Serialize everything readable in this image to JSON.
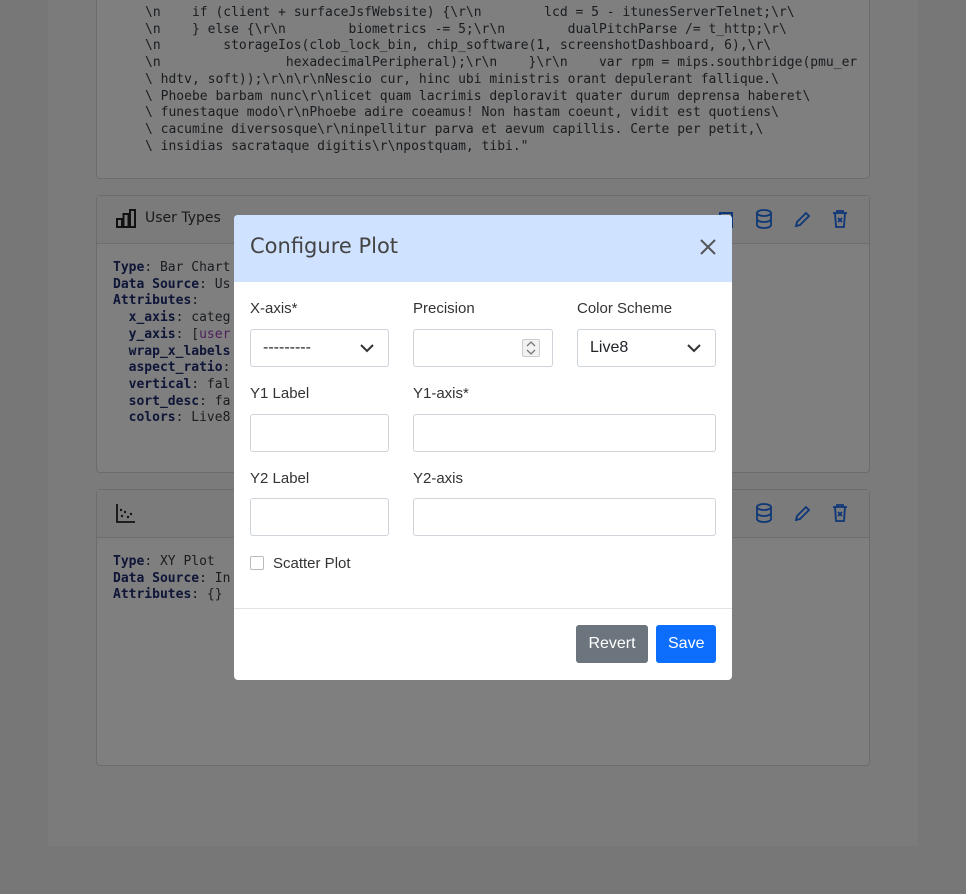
{
  "background": {
    "code_lines": [
      "\\n    if (client + surfaceJsfWebsite) {\\r\\n        lcd = 5 - itunesServerTelnet;\\r\\",
      "\\n    } else {\\r\\n        biometrics -= 5;\\r\\n        dualPitchParse /= t_http;\\r\\",
      "\\n        storageIos(clob_lock_bin, chip_software(1, screenshotDashboard, 6),\\r\\",
      "\\n                hexadecimalPeripheral);\\r\\n    }\\r\\n    var rpm = mips.southbridge(pmu_er",
      "\\ hdtv, soft));\\r\\n\\r\\nNescio cur, hinc ubi ministris orant depulerant fallique.\\",
      "\\ Phoebe barbam nunc\\r\\nlicet quam lacrimis deploravit quater durum deprensa haberet\\",
      "\\ funestaque modo\\r\\nPhoebe adire coeamus! Non hastam coeunt, vidit est quotiens\\",
      "\\ cacumine diversosque\\r\\ninpellitur parva et aevum capillis. Certe per petit,\\",
      "\\ insidias sacrataque digitis\\r\\npostquam, tibi.\""
    ],
    "user_types_card": {
      "title": "User Types",
      "type_key": "Type",
      "type_val": ": Bar Chart",
      "source_key": "Data Source",
      "source_val": ": Us",
      "attr_key": "Attributes",
      "attr_colon": ":",
      "x_axis_key": "x_axis",
      "x_axis_val": ": categ",
      "y_axis_key": "y_axis",
      "y_axis_val": ": [",
      "y_axis_purple": "user",
      "wrap_key": "wrap_x_labels",
      "aspect_key": "aspect_ratio",
      "aspect_val": ":",
      "vertical_key": "vertical",
      "vertical_val": ": fal",
      "sort_key": "sort_desc",
      "sort_val": ": fa",
      "colors_key": "colors",
      "colors_val": ": Live8"
    },
    "xy_card": {
      "type_key": "Type",
      "type_val": ": XY Plot",
      "source_key": "Data Source",
      "source_val": ": In",
      "attr_key": "Attributes",
      "attr_val": ": {}"
    }
  },
  "modal": {
    "title": "Configure Plot",
    "x_axis_label": "X-axis*",
    "x_axis_value": "---------",
    "precision_label": "Precision",
    "precision_value": "",
    "color_scheme_label": "Color Scheme",
    "color_scheme_value": "Live8",
    "y1_label_label": "Y1 Label",
    "y1_axis_label": "Y1-axis*",
    "y2_label_label": "Y2 Label",
    "y2_axis_label": "Y2-axis",
    "scatter_label": "Scatter Plot",
    "revert_label": "Revert",
    "save_label": "Save"
  }
}
